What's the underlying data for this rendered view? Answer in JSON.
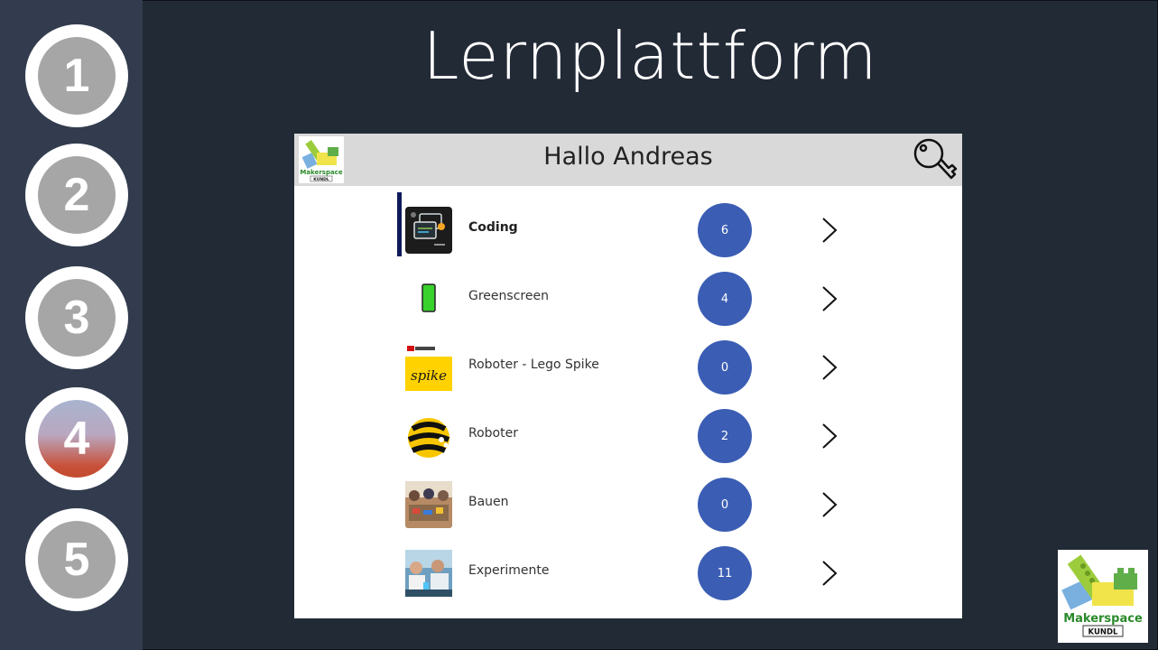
{
  "slide": {
    "title": "Lernplattform"
  },
  "steps": [
    {
      "number": "1",
      "active": false
    },
    {
      "number": "2",
      "active": false
    },
    {
      "number": "3",
      "active": false
    },
    {
      "number": "4",
      "active": true
    },
    {
      "number": "5",
      "active": false
    }
  ],
  "app": {
    "greeting": "Hallo Andreas",
    "logo_text": {
      "line1": "Makerspace",
      "line2": "KUNDL"
    },
    "header_icons": {
      "logo": "makerspace-logo-icon",
      "action": "key-icon"
    },
    "rows": [
      {
        "label": "Coding",
        "count": "6",
        "icon": "coding-icon",
        "selected": true
      },
      {
        "label": "Greenscreen",
        "count": "4",
        "icon": "phone-greenscreen-icon",
        "selected": false
      },
      {
        "label": "Roboter - Lego Spike",
        "count": "0",
        "icon": "lego-spike-icon",
        "thumb_text": "spike",
        "selected": false
      },
      {
        "label": "Roboter",
        "count": "2",
        "icon": "bee-robot-icon",
        "selected": false
      },
      {
        "label": "Bauen",
        "count": "0",
        "icon": "building-photo-icon",
        "selected": false
      },
      {
        "label": "Experimente",
        "count": "11",
        "icon": "experiment-photo-icon",
        "selected": false
      }
    ]
  },
  "colors": {
    "background": "#222a36",
    "sidebar": "#323c4e",
    "badge": "#3b5db4",
    "selection": "#0f1a5a"
  }
}
